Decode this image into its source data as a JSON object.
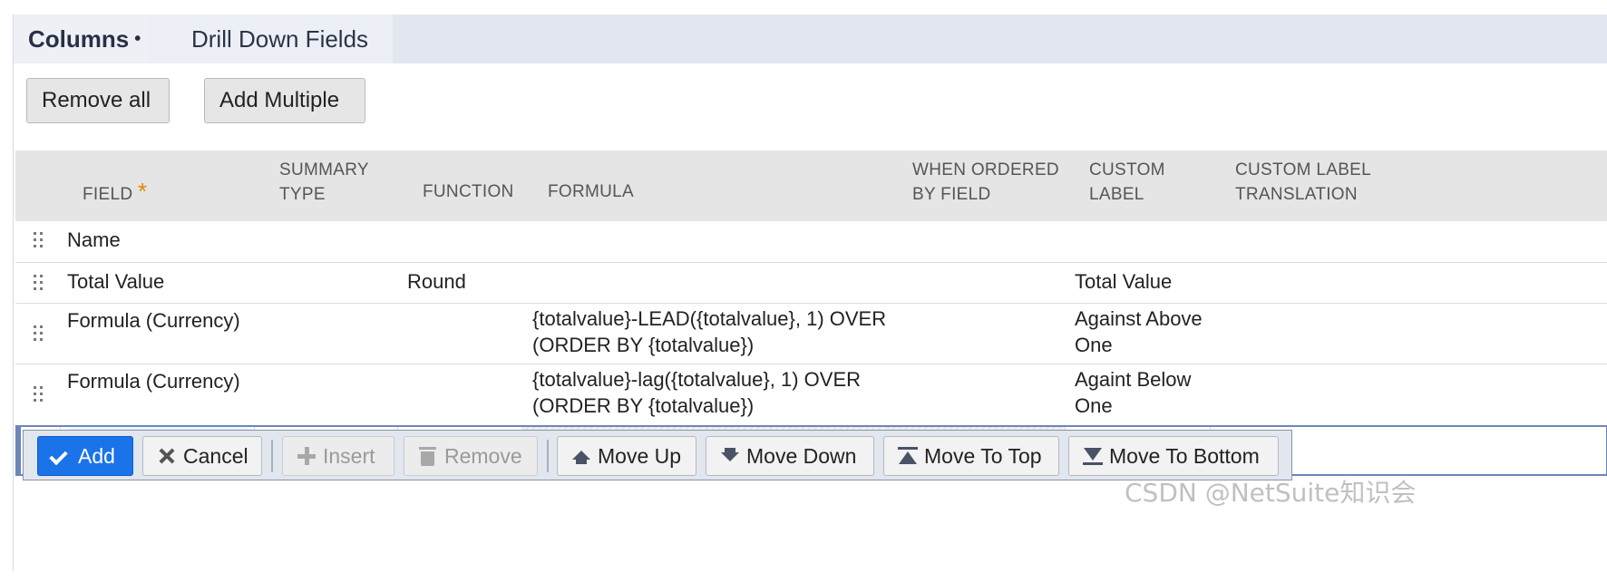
{
  "tabs": {
    "columns": {
      "label": "Columns",
      "dot": "•"
    },
    "drill_down": {
      "label": "Drill Down Fields"
    }
  },
  "toolbar": {
    "remove_all": "Remove all",
    "add_multiple": "Add Multiple"
  },
  "grid": {
    "headers": {
      "field": "FIELD",
      "required_mark": "*",
      "summary_type_1": "SUMMARY",
      "summary_type_2": "TYPE",
      "function": "FUNCTION",
      "formula": "FORMULA",
      "when_ordered_1": "WHEN ORDERED",
      "when_ordered_2": "BY FIELD",
      "custom_label_1": "CUSTOM",
      "custom_label_2": "LABEL",
      "translation_1": "CUSTOM LABEL",
      "translation_2": "TRANSLATION"
    },
    "rows": [
      {
        "field": "Name",
        "function": "",
        "formula_1": "",
        "formula_2": "",
        "label_1": "",
        "label_2": ""
      },
      {
        "field": "Total Value",
        "function": "Round",
        "formula_1": "",
        "formula_2": "",
        "label_1": "Total Value",
        "label_2": ""
      },
      {
        "field": "Formula (Currency)",
        "function": "",
        "formula_1": "{totalvalue}-LEAD({totalvalue}, 1) OVER",
        "formula_2": "(ORDER BY {totalvalue})",
        "label_1": "Against Above",
        "label_2": "One"
      },
      {
        "field": "Formula (Currency)",
        "function": "",
        "formula_1": "{totalvalue}-lag({totalvalue}, 1) OVER",
        "formula_2": "(ORDER BY {totalvalue})",
        "label_1": "Againt Below",
        "label_2": "One"
      }
    ]
  },
  "actions": {
    "add": "Add",
    "cancel": "Cancel",
    "insert": "Insert",
    "remove": "Remove",
    "move_up": "Move Up",
    "move_down": "Move Down",
    "move_to_top": "Move To Top",
    "move_to_bottom": "Move To Bottom"
  },
  "watermark": "CSDN @NetSuite知识会",
  "colors": {
    "primary": "#1a73e8",
    "tab_strip": "#e2e6ef",
    "header_bg": "#e5e5e5",
    "required": "#e08a00"
  }
}
